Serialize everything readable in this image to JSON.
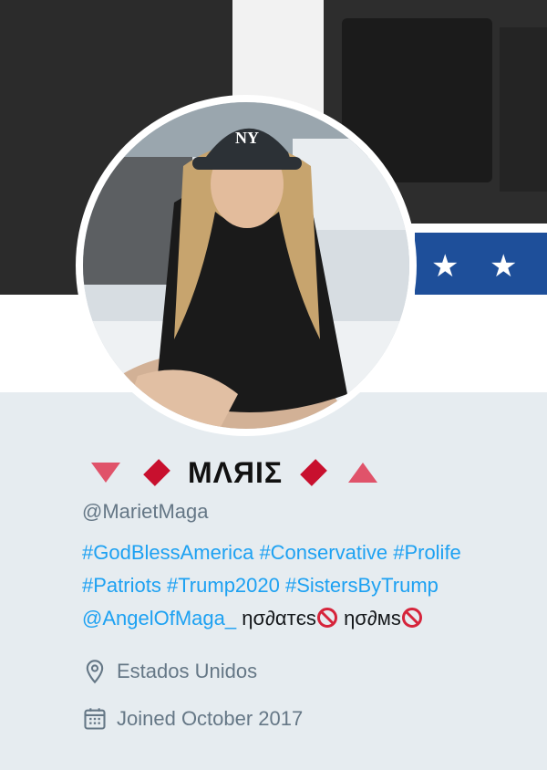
{
  "profile": {
    "display_name": "ΜΛЯIΣ",
    "handle": "@MarietMaga",
    "bio": {
      "tag1": "#GodBlessAmerica",
      "tag2": "#Conservative",
      "tag3": "#Prolife",
      "tag4": "#Patriots",
      "tag5": "#Trump2020",
      "tag6": "#SistersByTrump",
      "mention": "@AngelOfMaga_",
      "text1": "ησ∂αтєѕ",
      "text2": "ησ∂мѕ"
    },
    "location": "Estados Unidos",
    "joined": "Joined October 2017"
  },
  "colors": {
    "link": "#1da1f2",
    "muted": "#657786",
    "background": "#e6ecf0",
    "accent_red": "#c8102e",
    "accent_pink": "#e0536a"
  },
  "icons": {
    "location": "map-pin-icon",
    "calendar": "calendar-icon",
    "prohibited": "no-entry-emoji-icon"
  }
}
